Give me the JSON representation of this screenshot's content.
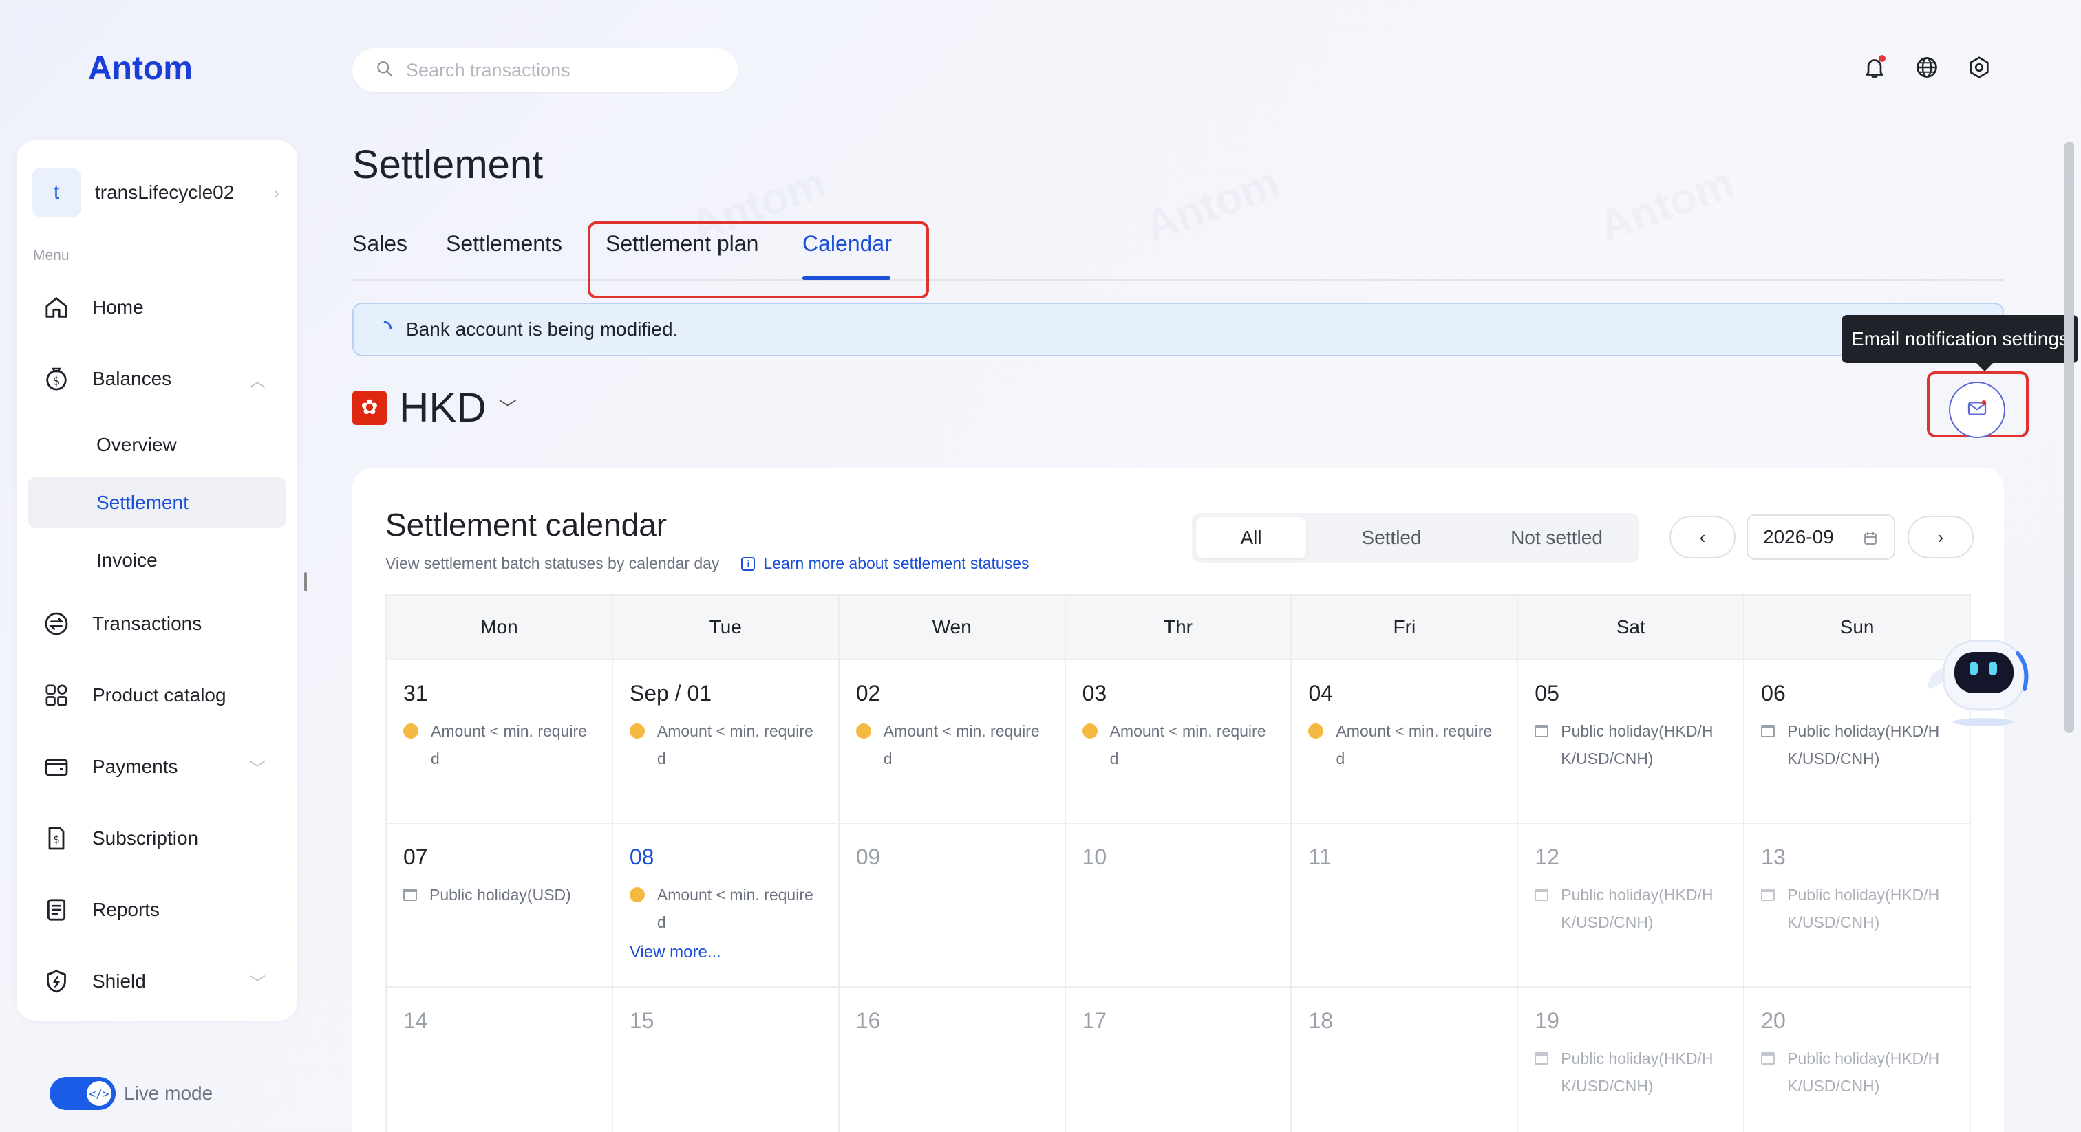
{
  "brand": {
    "logo": "Antom"
  },
  "search": {
    "placeholder": "Search transactions"
  },
  "account": {
    "initial": "t",
    "name": "transLifecycle02"
  },
  "sidebar": {
    "menu_label": "Menu",
    "items": [
      {
        "label": "Home",
        "icon": "home-icon"
      },
      {
        "label": "Balances",
        "icon": "wallet-icon",
        "expanded": true
      },
      {
        "label": "Overview",
        "sub": true
      },
      {
        "label": "Settlement",
        "sub": true,
        "active": true
      },
      {
        "label": "Invoice",
        "sub": true
      },
      {
        "label": "Transactions",
        "icon": "transactions-icon"
      },
      {
        "label": "Product catalog",
        "icon": "grid-icon"
      },
      {
        "label": "Payments",
        "icon": "payments-icon",
        "expanded": false
      },
      {
        "label": "Subscription",
        "icon": "subscription-icon"
      },
      {
        "label": "Reports",
        "icon": "reports-icon"
      },
      {
        "label": "Shield",
        "icon": "shield-icon",
        "expanded": false
      }
    ],
    "live_mode": "Live mode"
  },
  "page": {
    "title": "Settlement"
  },
  "tabs": [
    {
      "label": "Sales"
    },
    {
      "label": "Settlements"
    },
    {
      "label": "Settlement plan"
    },
    {
      "label": "Calendar",
      "active": true
    }
  ],
  "banner": {
    "text": "Bank account is being modified."
  },
  "currency": {
    "code": "HKD"
  },
  "tooltip": {
    "text": "Email notification settings"
  },
  "calendar": {
    "title": "Settlement calendar",
    "subtitle": "View settlement batch statuses by calendar day",
    "learn_more": "Learn more about settlement statuses",
    "filters": [
      "All",
      "Settled",
      "Not settled"
    ],
    "selected_filter": "All",
    "month": "2026-09",
    "weekdays": [
      "Mon",
      "Tue",
      "Wen",
      "Thr",
      "Fri",
      "Sat",
      "Sun"
    ],
    "weeks": [
      [
        {
          "day": "31",
          "status": "Amount < min. required",
          "kind": "warn"
        },
        {
          "day": "Sep / 01",
          "status": "Amount < min. required",
          "kind": "warn"
        },
        {
          "day": "02",
          "status": "Amount < min. required",
          "kind": "warn"
        },
        {
          "day": "03",
          "status": "Amount < min. required",
          "kind": "warn"
        },
        {
          "day": "04",
          "status": "Amount < min. required",
          "kind": "warn"
        },
        {
          "day": "05",
          "status": "Public holiday(HKD/HK/USD/CNH)",
          "kind": "holiday"
        },
        {
          "day": "06",
          "status": "Public holiday(HKD/HK/USD/CNH)",
          "kind": "holiday"
        }
      ],
      [
        {
          "day": "07",
          "status": "Public holiday(USD)",
          "kind": "holiday"
        },
        {
          "day": "08",
          "status": "Amount < min. required",
          "kind": "warn",
          "today": true,
          "more": "View more..."
        },
        {
          "day": "09",
          "muted": true
        },
        {
          "day": "10",
          "muted": true
        },
        {
          "day": "11",
          "muted": true
        },
        {
          "day": "12",
          "status": "Public holiday(HKD/HK/USD/CNH)",
          "kind": "holiday",
          "muted": true
        },
        {
          "day": "13",
          "status": "Public holiday(HKD/HK/USD/CNH)",
          "kind": "holiday",
          "muted": true
        }
      ],
      [
        {
          "day": "14",
          "muted": true
        },
        {
          "day": "15",
          "muted": true
        },
        {
          "day": "16",
          "muted": true
        },
        {
          "day": "17",
          "muted": true
        },
        {
          "day": "18",
          "muted": true
        },
        {
          "day": "19",
          "status": "Public holiday(HKD/HK/USD/CNH)",
          "kind": "holiday",
          "muted": true
        },
        {
          "day": "20",
          "status": "Public holiday(HKD/HK/USD/CNH)",
          "kind": "holiday",
          "muted": true
        }
      ]
    ]
  },
  "colors": {
    "accent": "#1a4fd6",
    "highlight": "#e0322f",
    "warning": "#f5b841"
  }
}
